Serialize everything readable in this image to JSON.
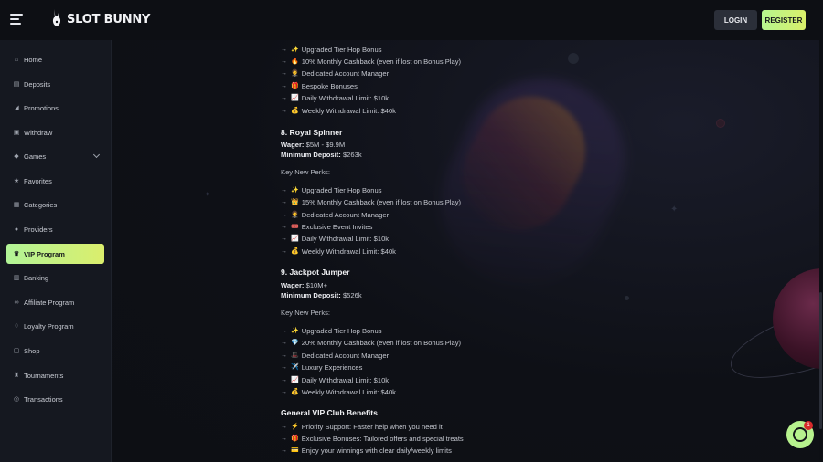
{
  "header": {
    "logo_text": "SLOT BUNNY",
    "login_label": "LOGIN",
    "register_label": "REGISTER"
  },
  "sidebar": {
    "items": [
      {
        "label": "Home",
        "icon": "home-icon"
      },
      {
        "label": "Deposits",
        "icon": "wallet-icon"
      },
      {
        "label": "Promotions",
        "icon": "megaphone-icon"
      },
      {
        "label": "Withdraw",
        "icon": "withdraw-icon"
      },
      {
        "label": "Games",
        "icon": "games-icon"
      },
      {
        "label": "Favorites",
        "icon": "star-icon"
      },
      {
        "label": "Categories",
        "icon": "categories-icon"
      },
      {
        "label": "Providers",
        "icon": "providers-icon"
      },
      {
        "label": "VIP Program",
        "icon": "crown-icon"
      },
      {
        "label": "Banking",
        "icon": "bank-icon"
      },
      {
        "label": "Affiliate Program",
        "icon": "link-icon"
      },
      {
        "label": "Loyalty Program",
        "icon": "loyalty-icon"
      },
      {
        "label": "Shop",
        "icon": "shop-icon"
      },
      {
        "label": "Tournaments",
        "icon": "trophy-icon"
      },
      {
        "label": "Transactions",
        "icon": "transactions-icon"
      }
    ],
    "active": "VIP Program"
  },
  "content": {
    "top_perks": [
      {
        "emoji": "✨",
        "text": "Upgraded Tier Hop Bonus"
      },
      {
        "emoji": "🔥",
        "text": "10% Monthly Cashback (even if lost on Bonus Play)"
      },
      {
        "emoji": "🤵",
        "text": "Dedicated Account Manager"
      },
      {
        "emoji": "🎁",
        "text": "Bespoke Bonuses"
      },
      {
        "emoji": "📈",
        "text": "Daily Withdrawal Limit: $10k"
      },
      {
        "emoji": "💰",
        "text": "Weekly Withdrawal Limit: $40k"
      }
    ],
    "tier8": {
      "title": "8. Royal Spinner",
      "wager_label": "Wager:",
      "wager_value": "$5M - $9.9M",
      "min_deposit_label": "Minimum Deposit:",
      "min_deposit_value": "$263k",
      "perks_heading": "Key New Perks:",
      "perks": [
        {
          "emoji": "✨",
          "text": "Upgraded Tier Hop Bonus"
        },
        {
          "emoji": "👑",
          "text": "15% Monthly Cashback (even if lost on Bonus Play)"
        },
        {
          "emoji": "🤵",
          "text": "Dedicated Account Manager"
        },
        {
          "emoji": "🎟️",
          "text": "Exclusive Event Invites"
        },
        {
          "emoji": "📈",
          "text": "Daily Withdrawal Limit: $10k"
        },
        {
          "emoji": "💰",
          "text": "Weekly Withdrawal Limit: $40k"
        }
      ]
    },
    "tier9": {
      "title": "9. Jackpot Jumper",
      "wager_label": "Wager:",
      "wager_value": "$10M+",
      "min_deposit_label": "Minimum Deposit:",
      "min_deposit_value": "$526k",
      "perks_heading": "Key New Perks:",
      "perks": [
        {
          "emoji": "✨",
          "text": "Upgraded Tier Hop Bonus"
        },
        {
          "emoji": "💎",
          "text": "20% Monthly Cashback (even if lost on Bonus Play)"
        },
        {
          "emoji": "🎩",
          "text": "Dedicated Account Manager"
        },
        {
          "emoji": "✈️",
          "text": "Luxury Experiences"
        },
        {
          "emoji": "📈",
          "text": "Daily Withdrawal Limit: $10k"
        },
        {
          "emoji": "💰",
          "text": "Weekly Withdrawal Limit: $40k"
        }
      ]
    },
    "general": {
      "title": "General VIP Club Benefits",
      "items": [
        {
          "emoji": "⚡",
          "text": "Priority Support: Faster help when you need it"
        },
        {
          "emoji": "🎁",
          "text": "Exclusive Bonuses: Tailored offers and special treats"
        },
        {
          "emoji": "💳",
          "text": "Enjoy your winnings with clear daily/weekly limits"
        }
      ]
    }
  },
  "chat": {
    "badge_count": "1"
  },
  "colors": {
    "accent": "#b7f28e",
    "accent2": "#dbee6c",
    "background": "#0d0f14",
    "sidebar": "#151820"
  }
}
